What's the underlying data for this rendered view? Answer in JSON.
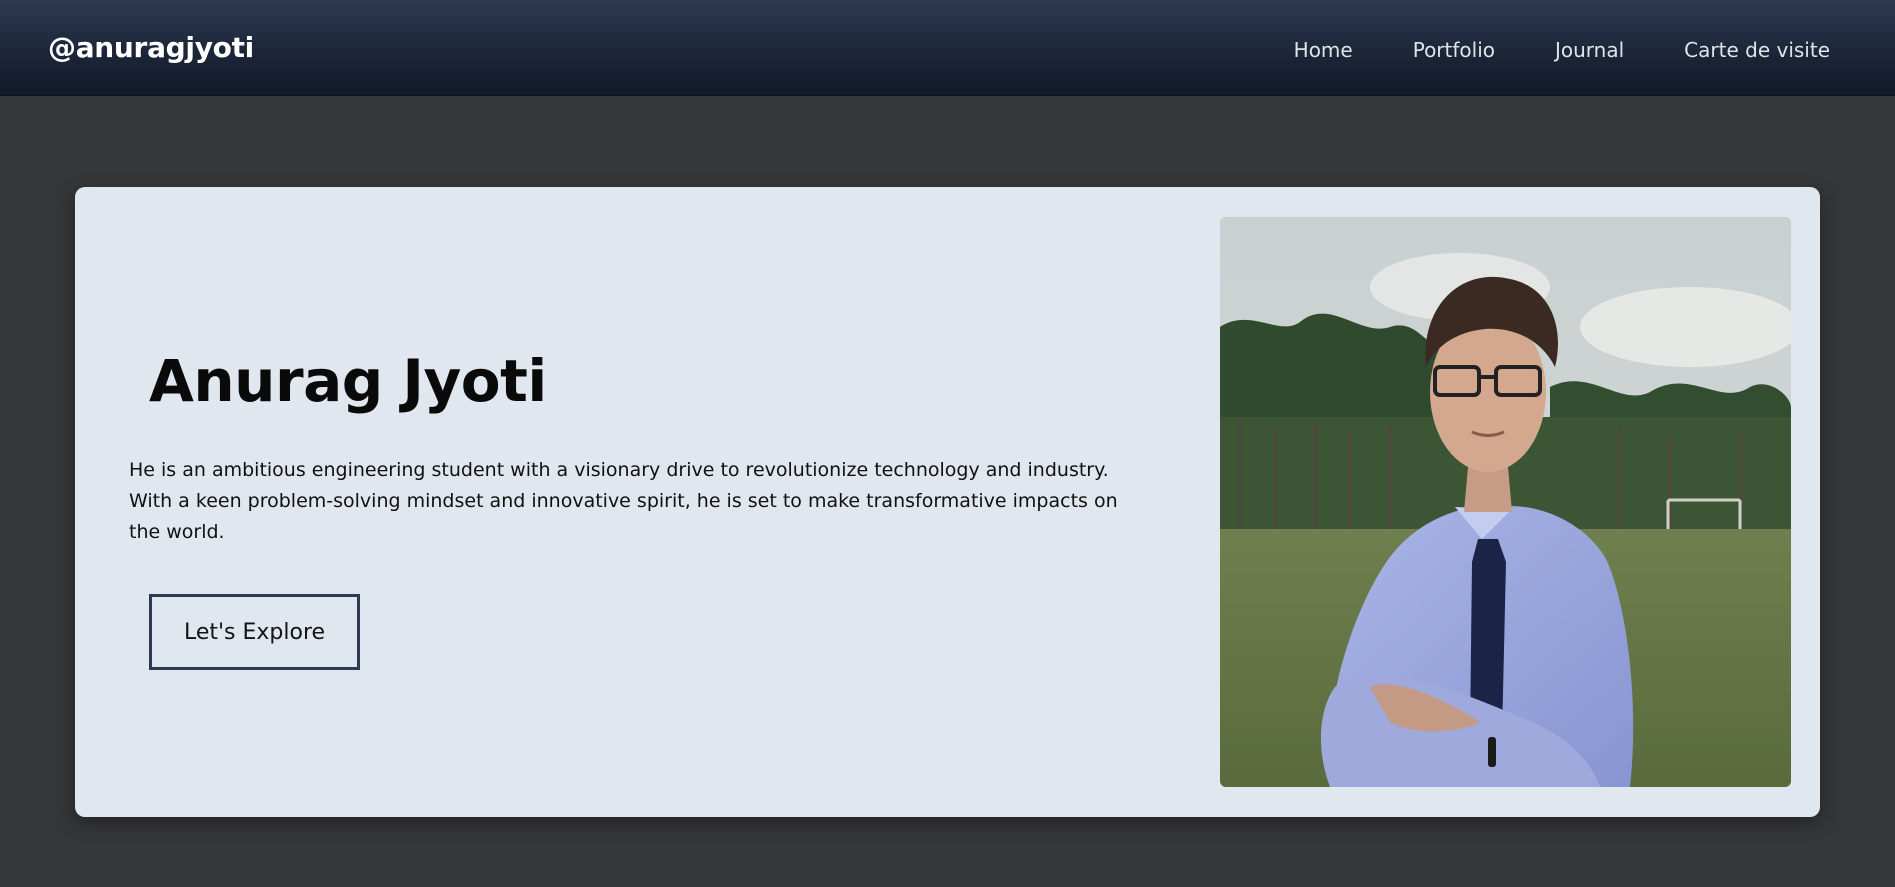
{
  "header": {
    "brand": "@anuragjyoti",
    "nav": [
      {
        "label": "Home"
      },
      {
        "label": "Portfolio"
      },
      {
        "label": "Journal"
      },
      {
        "label": "Carte de visite"
      }
    ]
  },
  "hero": {
    "title": "Anurag Jyoti",
    "description": "He is an ambitious engineering student with a visionary drive to revolutionize technology and industry. With a keen problem-solving mindset and innovative spirit, he is set to make transformative impacts on the world.",
    "cta_label": "Let's Explore"
  },
  "colors": {
    "page_background": "#353638",
    "header_top": "#2c3a52",
    "header_bottom": "#121a29",
    "card_background": "#e1e7ef",
    "button_border": "#2d3a50"
  }
}
